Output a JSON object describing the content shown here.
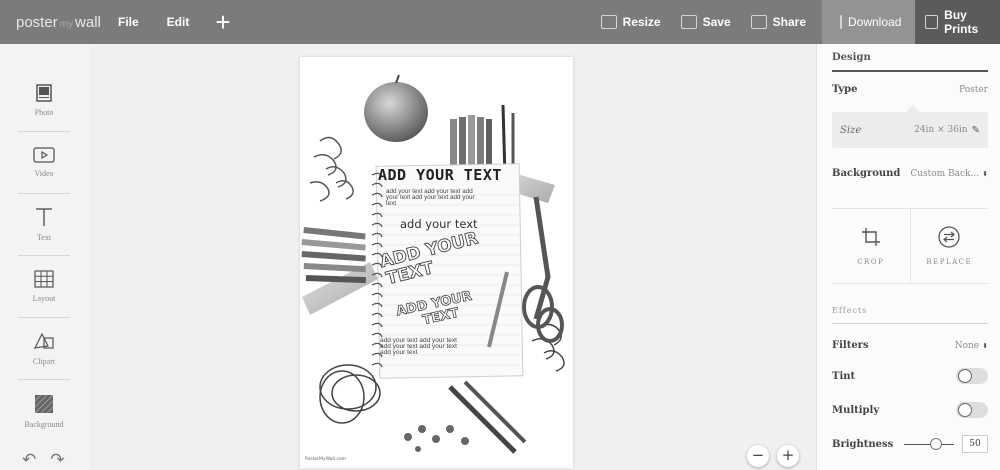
{
  "app": {
    "logo_left": "poster",
    "logo_mid": "my",
    "logo_right": "wall"
  },
  "menu": {
    "file": "File",
    "edit": "Edit",
    "add": "+"
  },
  "actions": {
    "resize": "Resize",
    "save": "Save",
    "share": "Share",
    "download": "Download",
    "buy_prints": "Buy Prints"
  },
  "tools": [
    {
      "label": "Photo",
      "icon": "photo-icon"
    },
    {
      "label": "Video",
      "icon": "video-icon"
    },
    {
      "label": "Text",
      "icon": "text-icon"
    },
    {
      "label": "Layout",
      "icon": "layout-icon"
    },
    {
      "label": "Clipart",
      "icon": "clipart-icon"
    },
    {
      "label": "Background",
      "icon": "background-icon"
    }
  ],
  "history": {
    "undo": "↶",
    "redo": "↷"
  },
  "poster": {
    "title": "ADD YOUR TEXT",
    "small_text": [
      "add your text add your text add",
      "your text add your text add your",
      "text"
    ],
    "mid_text": "add your text",
    "big_1": [
      "ADD YOUR",
      "TEXT"
    ],
    "big_2": [
      "ADD YOUR",
      "TEXT"
    ],
    "bottom_text": [
      "add your text add your text",
      "add your text add your text",
      "add your text"
    ],
    "credit": "PosterMyWall.com"
  },
  "zoom": {
    "out": "−",
    "in": "+"
  },
  "panel": {
    "tab": "Design",
    "type_label": "Type",
    "type_value": "Poster",
    "size_label": "Size",
    "size_value": "24in × 36in",
    "background_label": "Background",
    "background_value": "Custom Back...",
    "crop_label": "CROP",
    "replace_label": "REPLACE",
    "effects_title": "Effects",
    "filters_label": "Filters",
    "filters_value": "None",
    "tint_label": "Tint",
    "multiply_label": "Multiply",
    "brightness_label": "Brightness",
    "brightness_value": "50"
  },
  "settings": {
    "tint_on": false,
    "multiply_on": false,
    "brightness_level": 0.5
  },
  "colors": {
    "topbar": "#7b7b7b",
    "download_bg": "#939393",
    "buy_bg": "#5b5b5b"
  }
}
